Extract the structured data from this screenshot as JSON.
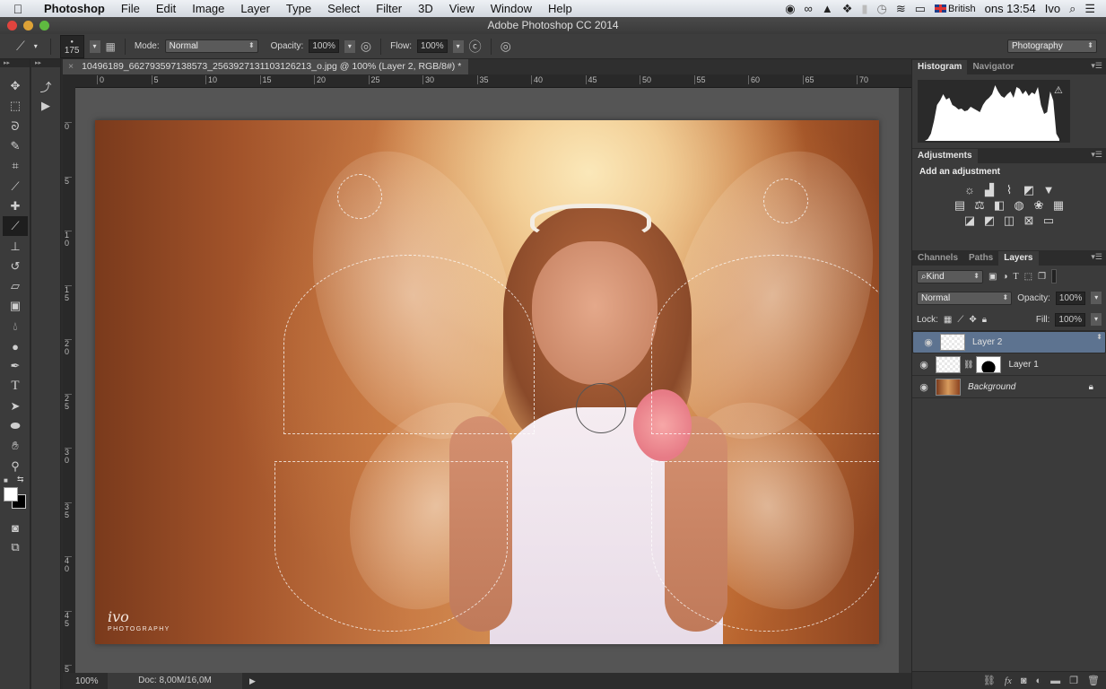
{
  "menubar": {
    "apple_icon": "apple-icon",
    "items": [
      "Photoshop",
      "File",
      "Edit",
      "Image",
      "Layer",
      "Type",
      "Select",
      "Filter",
      "3D",
      "View",
      "Window",
      "Help"
    ],
    "status_icons": [
      "record-icon",
      "creative-cloud-icon",
      "google-drive-icon",
      "dropbox-icon",
      "battery-bars-icon",
      "time-machine-icon",
      "wifi-icon",
      "battery-icon"
    ],
    "input_source": "British",
    "clock": "ons 13:54",
    "user": "Ivo"
  },
  "window": {
    "title": "Adobe Photoshop CC 2014"
  },
  "options": {
    "brush_size": "175",
    "mode_label": "Mode:",
    "mode_value": "Normal",
    "opacity_label": "Opacity:",
    "opacity_value": "100%",
    "flow_label": "Flow:",
    "flow_value": "100%",
    "workspace": "Photography"
  },
  "document": {
    "tab_title": "10496189_662793597138573_2563927131103126213_o.jpg @ 100% (Layer 2, RGB/8#) *",
    "close_glyph": "×",
    "h_ruler": [
      "0",
      "5",
      "10",
      "15",
      "20",
      "25",
      "30",
      "35",
      "40",
      "45",
      "50",
      "55",
      "60",
      "65",
      "70"
    ],
    "v_ruler": [
      "0",
      "5",
      "10",
      "15",
      "20",
      "25",
      "30",
      "35",
      "40",
      "45",
      "5"
    ],
    "watermark_script": "ivo",
    "watermark_text": "PHOTOGRAPHY"
  },
  "status": {
    "zoom": "100%",
    "doc": "Doc: 8,00M/16,0M",
    "arrow": "▶"
  },
  "tools": [
    "move",
    "marquee",
    "lasso",
    "quick-select",
    "crop",
    "eyedropper",
    "healing",
    "brush",
    "stamp",
    "history-brush",
    "eraser",
    "gradient",
    "blur",
    "dodge",
    "pen",
    "type",
    "path-select",
    "ellipse",
    "hand",
    "zoom"
  ],
  "panels": {
    "histogram_tabs": [
      "Histogram",
      "Navigator"
    ],
    "adjustments_tab": "Adjustments",
    "adjustments_title": "Add an adjustment",
    "adjustment_rows": [
      [
        "brightness-contrast",
        "levels",
        "curves",
        "exposure",
        "vibrance"
      ],
      [
        "hue-saturation",
        "color-balance",
        "black-white",
        "photo-filter",
        "channel-mixer",
        "color-lookup"
      ],
      [
        "invert",
        "posterize",
        "threshold",
        "selective-color",
        "gradient-map"
      ]
    ],
    "layer_tabs": [
      "Channels",
      "Paths",
      "Layers"
    ],
    "kind_label": "Kind",
    "blend_mode": "Normal",
    "opacity_label": "Opacity:",
    "opacity_value": "100%",
    "lock_label": "Lock:",
    "fill_label": "Fill:",
    "fill_value": "100%",
    "layers": [
      {
        "name": "Layer 2",
        "selected": true
      },
      {
        "name": "Layer 1",
        "selected": false,
        "mask": true
      },
      {
        "name": "Background",
        "selected": false,
        "locked": true
      }
    ]
  },
  "colors": {
    "accent_selected_layer": "#5d7390",
    "foreground": "#ffffff",
    "background": "#000000"
  }
}
